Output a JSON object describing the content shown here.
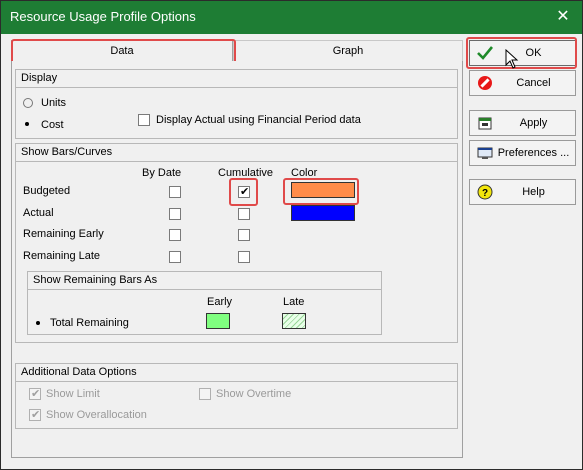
{
  "window": {
    "title": "Resource Usage Profile Options",
    "close_glyph": "✕"
  },
  "tabs": [
    {
      "label": "Data",
      "selected": true
    },
    {
      "label": "Graph",
      "selected": false
    }
  ],
  "display": {
    "header": "Display",
    "units_label": "Units",
    "cost_label": "Cost",
    "selected": "Cost",
    "financial_label": "Display Actual using Financial Period data",
    "financial_checked": false
  },
  "bars": {
    "header": "Show Bars/Curves",
    "col_by_date": "By Date",
    "col_cumulative": "Cumulative",
    "col_color": "Color",
    "rows": [
      {
        "label": "Budgeted",
        "by_date": false,
        "cumulative": true,
        "color": "#ff8c4a"
      },
      {
        "label": "Actual",
        "by_date": false,
        "cumulative": false,
        "color": "#0000ff"
      },
      {
        "label": "Remaining Early",
        "by_date": false,
        "cumulative": false
      },
      {
        "label": "Remaining Late",
        "by_date": false,
        "cumulative": false
      }
    ]
  },
  "remaining": {
    "header": "Show Remaining Bars As",
    "col_early": "Early",
    "col_late": "Late",
    "option_label": "Total Remaining",
    "early_color": "#80ff80",
    "late_color": "#e8ffe8"
  },
  "additional": {
    "header": "Additional Data Options",
    "show_limit": "Show Limit",
    "show_overtime": "Show Overtime",
    "show_overallocation": "Show Overallocation"
  },
  "buttons": {
    "ok": "OK",
    "cancel": "Cancel",
    "apply": "Apply",
    "preferences": "Preferences ...",
    "help": "Help"
  },
  "colors": {
    "title_bar": "#1e7d34",
    "highlight": "#e04a4a"
  }
}
